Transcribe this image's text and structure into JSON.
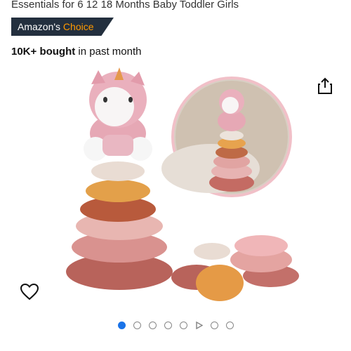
{
  "product": {
    "title": "Essentials for 6 12 18 Months Baby Toddler Girls",
    "badge_prefix": "Amazon's",
    "badge_highlight": "Choice",
    "bought_count": "10K+ bought",
    "bought_suffix": " in past month"
  },
  "icons": {
    "share": "share-icon",
    "wishlist": "heart-icon",
    "carousel_play": "play-icon"
  },
  "carousel": {
    "total_indicators": 8,
    "active_index": 0,
    "video_indicator_index": 5
  },
  "colors": {
    "badge_bg": "#232f3e",
    "badge_accent": "#ff9900",
    "active_dot": "#1a73e8"
  }
}
